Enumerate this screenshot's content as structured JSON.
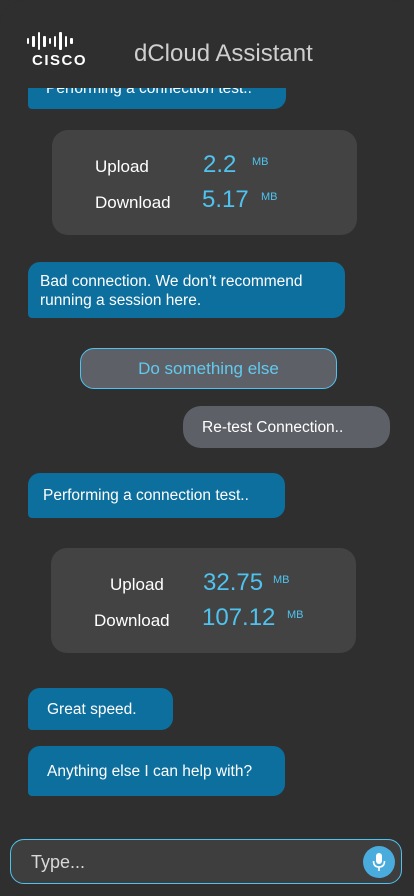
{
  "header": {
    "logo_text": "CISCO",
    "title": "dCloud Assistant"
  },
  "messages": {
    "clipped_top": "Performing a connection test..",
    "bad_connection": "Bad connection. We don’t recommend running a session here.",
    "retest_user": "Re-test Connection..",
    "performing": "Performing a connection test..",
    "great_speed": "Great speed.",
    "anything_else": "Anything else I can help with?"
  },
  "test1": {
    "upload_label": "Upload",
    "upload_value": "2.2",
    "upload_unit": "MB",
    "download_label": "Download",
    "download_value": "5.17",
    "download_unit": "MB"
  },
  "test2": {
    "upload_label": "Upload",
    "upload_value": "32.75",
    "upload_unit": "MB",
    "download_label": "Download",
    "download_value": "107.12",
    "download_unit": "MB"
  },
  "quick_reply": {
    "label": "Do something else"
  },
  "input": {
    "placeholder": "Type..."
  },
  "icons": {
    "mic": "microphone-icon",
    "logo": "cisco-logo"
  },
  "colors": {
    "background": "#2f2f2f",
    "bot_bubble": "#0d6f9e",
    "user_bubble": "#5d6167",
    "card": "#434343",
    "accent": "#4fc3ef"
  }
}
